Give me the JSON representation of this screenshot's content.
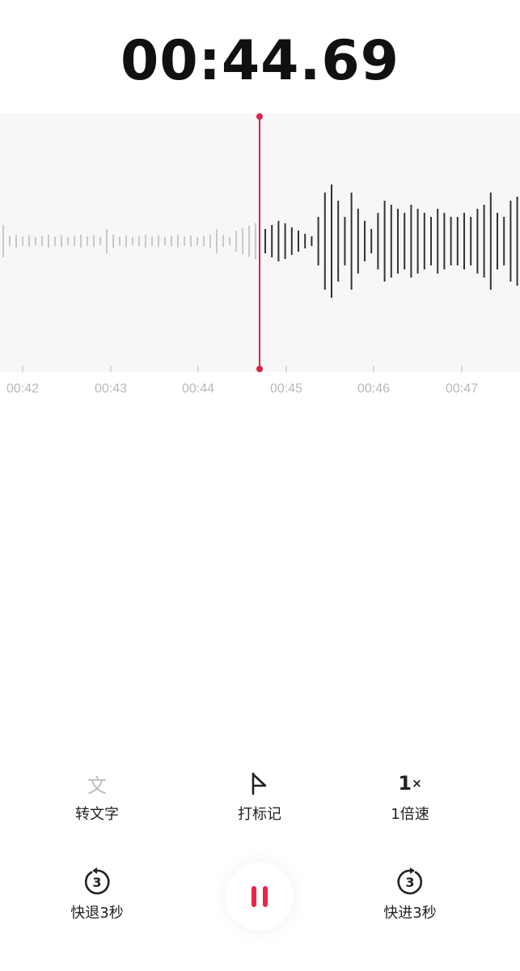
{
  "timer": "00:44.69",
  "waveform": {
    "playhead_color": "#d9234a",
    "tick_labels": [
      "00:42",
      "00:43",
      "00:44",
      "00:45",
      "00:46",
      "00:47"
    ]
  },
  "controls": {
    "transcribe": {
      "icon": "文",
      "label": "转文字"
    },
    "mark": {
      "label": "打标记"
    },
    "speed": {
      "icon_value": "1",
      "icon_unit": "×",
      "label": "1倍速"
    },
    "rewind": {
      "icon_value": "3",
      "label": "快退3秒"
    },
    "forward": {
      "icon_value": "3",
      "label": "快进3秒"
    }
  },
  "accent_color": "#e8284a"
}
